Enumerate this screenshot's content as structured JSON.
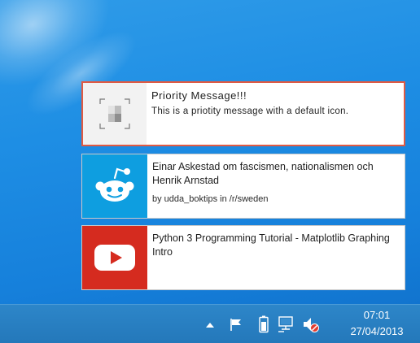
{
  "notifications": [
    {
      "kind": "priority",
      "icon": "default-app-icon",
      "title": "Priority Message!!!",
      "text": "This is a priotity message with a default icon.",
      "border_color": "#e05a43"
    },
    {
      "kind": "reddit",
      "icon": "reddit-alien-icon",
      "title": "Einar Askestad om fascismen, nationalismen och Henrik Arnstad",
      "subtitle": "by udda_boktips in /r/sweden",
      "brand_color": "#0e9ee0"
    },
    {
      "kind": "youtube",
      "icon": "youtube-play-icon",
      "title": "Python 3 Programming Tutorial - Matplotlib Graphing Intro",
      "brand_color": "#d52b1f"
    }
  ],
  "taskbar": {
    "tray_icons": [
      "show-hidden-icons-chevron",
      "action-center-flag-icon",
      "battery-icon",
      "network-icon",
      "speaker-muted-icon"
    ],
    "clock": {
      "time": "07:01",
      "date": "27/04/2013"
    }
  },
  "colors": {
    "desktop": "#1e8ee4",
    "taskbar": "#2478ba"
  }
}
